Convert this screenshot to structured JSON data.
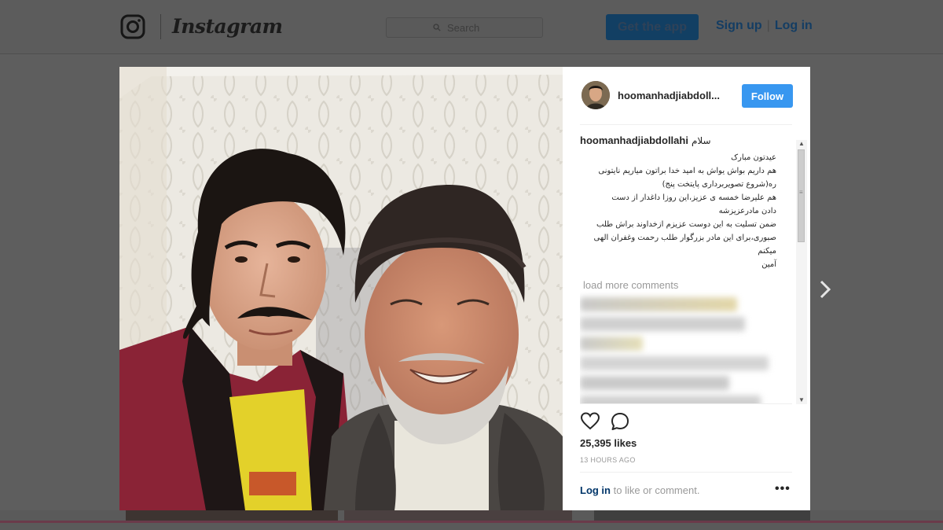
{
  "header": {
    "brand": "Instagram",
    "logo_icon": "instagram-camera-icon",
    "search_placeholder": "Search",
    "search_icon": "search-icon",
    "get_app_label": "Get the app",
    "sign_up_label": "Sign up",
    "separator": "|",
    "log_in_label": "Log in"
  },
  "post": {
    "photo_alt": "Two men smiling in a selfie",
    "username": "hoomanhadjiabdollahi",
    "username_truncated": "hoomanhadjiabdoll...",
    "follow_label": "Follow",
    "caption": {
      "first_word": "سلام",
      "lines": [
        "عیدتون مبارک",
        "هم داریم بواش یواش به امید خدا براتون میاریم نایتونی",
        "ره(شروع تصویربرداری پایتخت پنج)",
        "هم علیرضا خمسه ی عزیز،این روزا داغدار از دست",
        "دادن مادرعزیزشه",
        "ضمن تسلیت به این دوست عزیزم ازخداوند براش طلب",
        "صبوری،برای این مادر بزرگوار طلب رحمت وغفران الهی",
        "میکنم",
        "آمین"
      ]
    },
    "load_more_label": "load more comments",
    "likes": "25,395 likes",
    "time_ago": "13 HOURS AGO",
    "login_link": "Log in",
    "login_suffix": " to like or comment.",
    "more_options": "•••",
    "like_icon": "heart-icon",
    "comment_icon": "comment-bubble-icon"
  },
  "nav": {
    "next_icon": "chevron-right-icon"
  },
  "colors": {
    "follow_blue": "#3897f0",
    "overlay": "#5e5e5e",
    "link": "#003569"
  }
}
